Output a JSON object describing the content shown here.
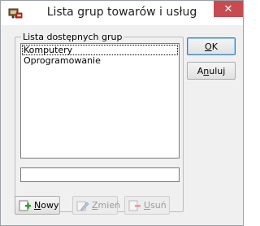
{
  "window": {
    "title": "Lista grup towarów i usług",
    "close_glyph": "✕",
    "icon": "app-icon"
  },
  "group": {
    "label": "Lista dostępnych grup",
    "items": [
      "Komputery",
      "Oprogramowanie"
    ],
    "selected_index": 0
  },
  "search": {
    "value": ""
  },
  "buttons": {
    "ok": {
      "mnemonic": "O",
      "rest": "K"
    },
    "cancel": {
      "pre": "A",
      "mnemonic": "n",
      "rest": "uluj"
    },
    "new": {
      "mnemonic": "N",
      "rest": "owy",
      "icon": "add-icon"
    },
    "edit": {
      "mnemonic": "Z",
      "rest": "mień",
      "icon": "edit-icon"
    },
    "delete": {
      "mnemonic": "U",
      "rest": "suń",
      "icon": "delete-icon"
    }
  },
  "colors": {
    "close_button": "#c74b50",
    "default_button_border": "#3c7fb1"
  }
}
